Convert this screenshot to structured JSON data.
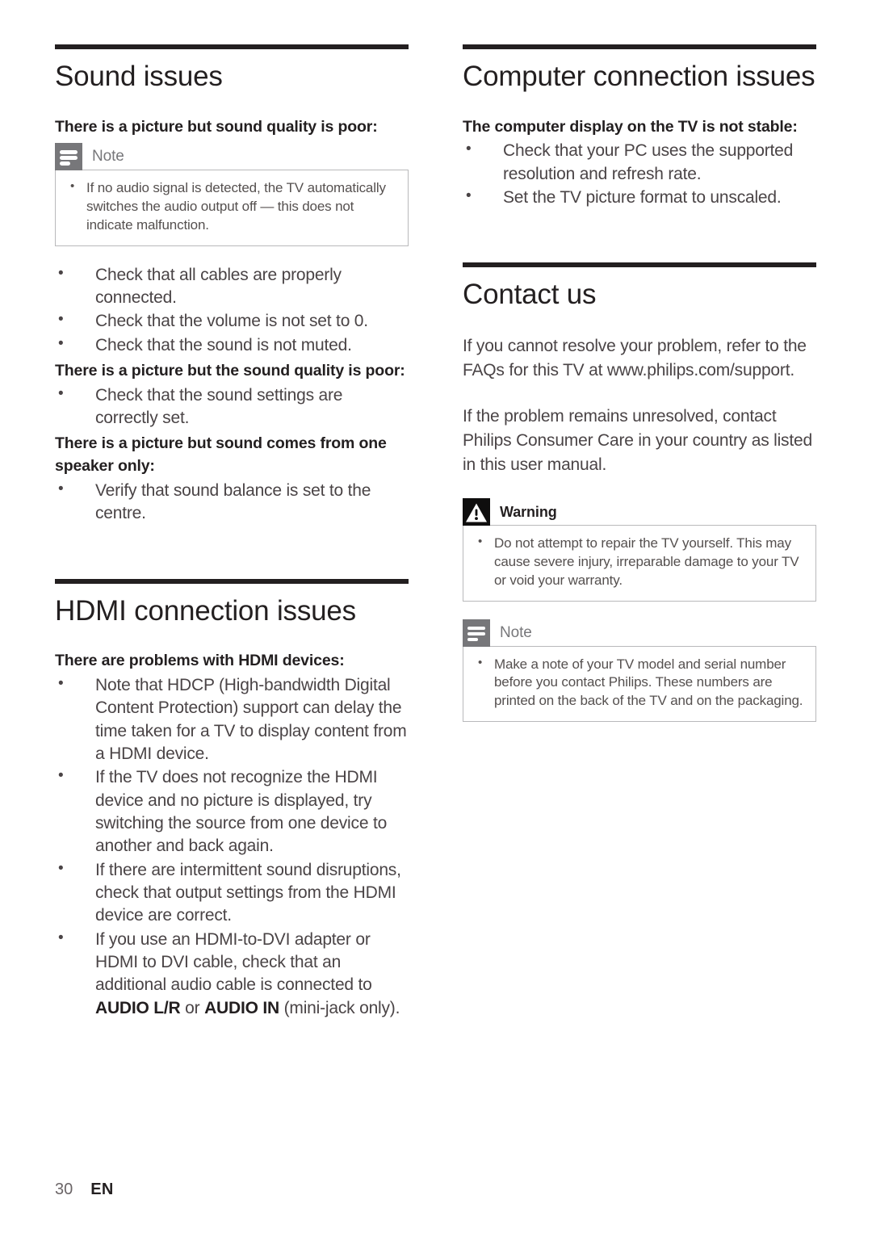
{
  "page": {
    "number": "30",
    "language": "EN"
  },
  "colors": {
    "rule": "#231f20",
    "heading": "#231f20",
    "body": "#4a4446",
    "note_icon_bg": "#77777a",
    "warning_icon_bg": "#0f0e0e",
    "callout_border": "#b9b9bb"
  },
  "left_column": {
    "sections": [
      {
        "title": "Sound issues",
        "subhead_1": "There is a picture but sound quality is poor:",
        "note": {
          "label": "Note",
          "icon": "note-icon",
          "items": [
            "If no audio signal is detected, the TV automatically switches the audio output off — this does not indicate malfunction."
          ]
        },
        "bullets_1": [
          "Check that all cables are properly connected.",
          "Check that the volume is not set to 0.",
          "Check that the sound is not muted."
        ],
        "subhead_2": "There is a picture but the sound quality is poor:",
        "bullets_2": [
          "Check that the sound settings are correctly set."
        ],
        "subhead_3": "There is a picture but sound comes from one speaker only:",
        "bullets_3": [
          "Verify that sound balance is set to the centre."
        ]
      },
      {
        "title": "HDMI connection issues",
        "subhead_1": "There are problems with HDMI devices:",
        "bullets_1": [
          "Note that HDCP (High-bandwidth Digital Content Protection) support can delay the time taken for a TV to display content from a HDMI device.",
          "If the TV does not recognize the HDMI device and no picture is displayed, try switching the source from one device to another and back again.",
          "If there are intermittent sound disruptions, check that output settings from the HDMI device are correct."
        ],
        "bullet_hdmi_dvi": {
          "prefix": "If you use an HDMI-to-DVI adapter or HDMI to DVI cable, check that an additional audio cable is connected to ",
          "bold_1": "AUDIO L/R",
          "middle": " or ",
          "bold_2": "AUDIO IN",
          "suffix": " (mini-jack only)."
        }
      }
    ]
  },
  "right_column": {
    "sections": [
      {
        "title": "Computer connection issues",
        "subhead_1": "The computer display on the TV is not stable:",
        "bullets_1": [
          "Check that your PC uses the supported resolution and refresh rate.",
          "Set the TV picture format to unscaled."
        ]
      },
      {
        "title": "Contact us",
        "para_1": "If you cannot resolve your problem, refer to the FAQs for this TV at www.philips.com/support.",
        "para_2": "If the problem remains unresolved, contact Philips Consumer Care in your country as listed in this user manual.",
        "warning": {
          "label": "Warning",
          "icon": "warning-triangle-icon",
          "items": [
            "Do not attempt to repair the TV yourself. This may cause severe injury, irreparable damage to your TV or void your warranty."
          ]
        },
        "note": {
          "label": "Note",
          "icon": "note-icon",
          "items": [
            "Make a note of your TV model and serial number before you contact Philips. These numbers are printed on the back of the TV and on the packaging."
          ]
        }
      }
    ]
  }
}
